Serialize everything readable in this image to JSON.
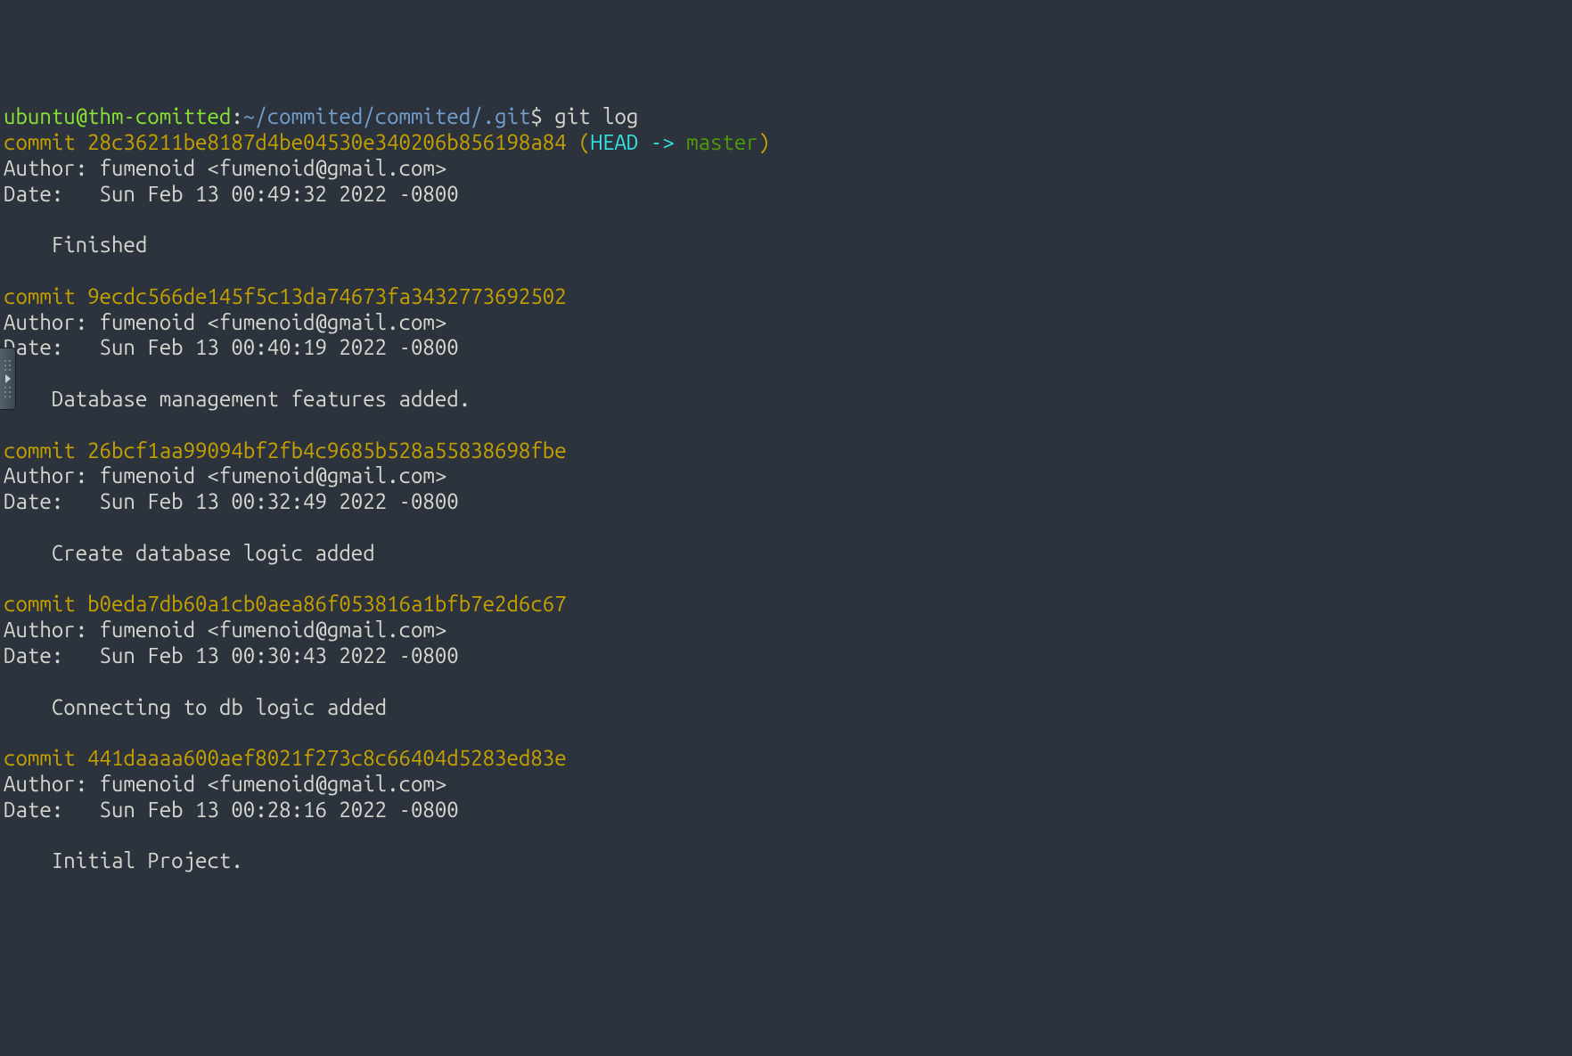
{
  "prompt": {
    "user": "ubuntu",
    "at": "@",
    "host": "thm-comitted",
    "colon": ":",
    "path": "~/commited/commited/.git",
    "dollar": "$",
    "command": "git log"
  },
  "head_ref": {
    "open": " (",
    "head": "HEAD -> ",
    "branch": "master",
    "close": ")"
  },
  "commits": [
    {
      "label": "commit ",
      "hash": "28c36211be8187d4be04530e340206b856198a84",
      "is_head": true,
      "author_label": "Author: ",
      "author": "fumenoid <fumenoid@gmail.com>",
      "date_label": "Date:   ",
      "date": "Sun Feb 13 00:49:32 2022 -0800",
      "message_indent": "    ",
      "message": "Finished"
    },
    {
      "label": "commit ",
      "hash": "9ecdc566de145f5c13da74673fa3432773692502",
      "is_head": false,
      "author_label": "Author: ",
      "author": "fumenoid <fumenoid@gmail.com>",
      "date_label": "Date:   ",
      "date": "Sun Feb 13 00:40:19 2022 -0800",
      "message_indent": "    ",
      "message": "Database management features added."
    },
    {
      "label": "commit ",
      "hash": "26bcf1aa99094bf2fb4c9685b528a55838698fbe",
      "is_head": false,
      "author_label": "Author: ",
      "author": "fumenoid <fumenoid@gmail.com>",
      "date_label": "Date:   ",
      "date": "Sun Feb 13 00:32:49 2022 -0800",
      "message_indent": "    ",
      "message": "Create database logic added"
    },
    {
      "label": "commit ",
      "hash": "b0eda7db60a1cb0aea86f053816a1bfb7e2d6c67",
      "is_head": false,
      "author_label": "Author: ",
      "author": "fumenoid <fumenoid@gmail.com>",
      "date_label": "Date:   ",
      "date": "Sun Feb 13 00:30:43 2022 -0800",
      "message_indent": "    ",
      "message": "Connecting to db logic added"
    },
    {
      "label": "commit ",
      "hash": "441daaaa600aef8021f273c8c66404d5283ed83e",
      "is_head": false,
      "author_label": "Author: ",
      "author": "fumenoid <fumenoid@gmail.com>",
      "date_label": "Date:   ",
      "date": "Sun Feb 13 00:28:16 2022 -0800",
      "message_indent": "    ",
      "message": "Initial Project."
    }
  ]
}
